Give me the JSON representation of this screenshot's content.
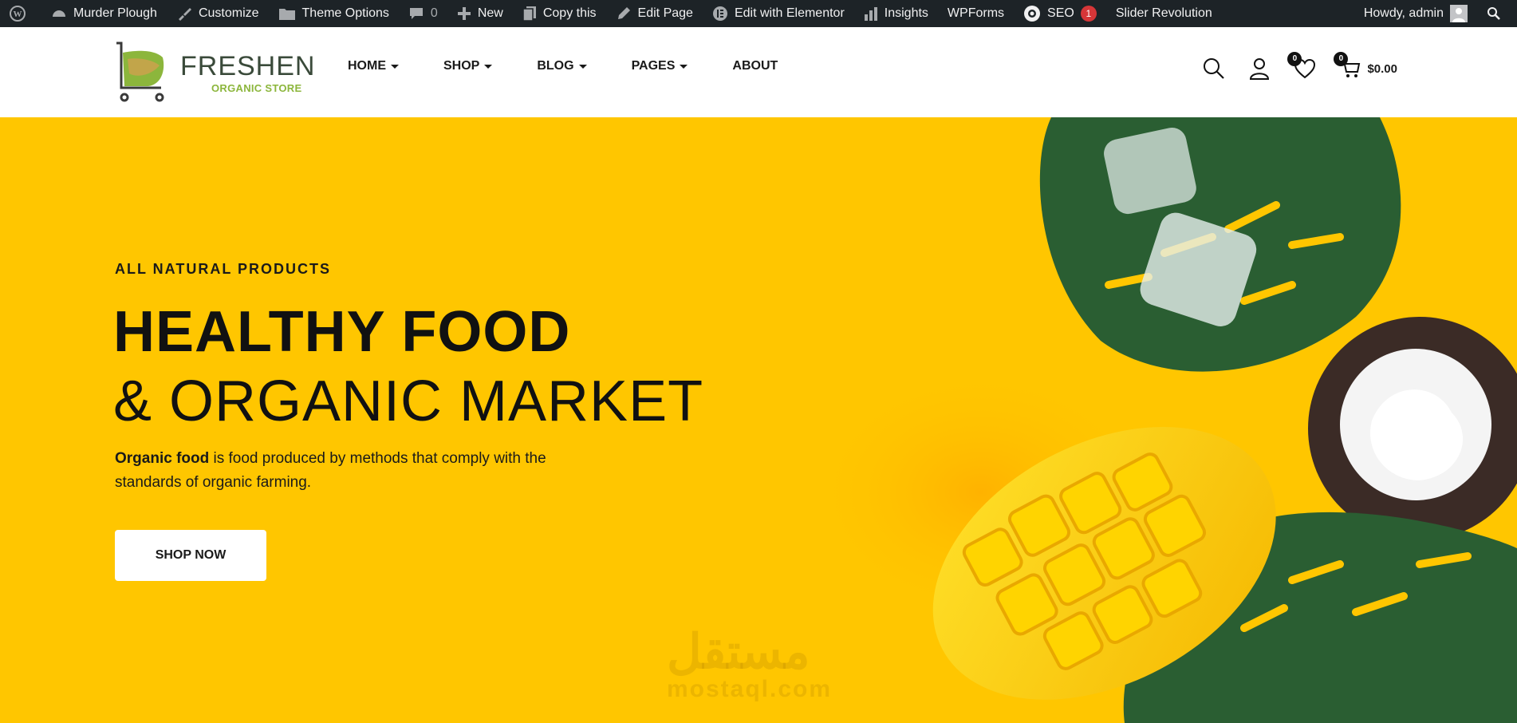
{
  "admin_bar": {
    "site_name": "Murder Plough",
    "customize": "Customize",
    "theme_options": "Theme Options",
    "comments_count": "0",
    "new": "New",
    "copy_this": "Copy this",
    "edit_page": "Edit Page",
    "edit_with_elementor": "Edit with Elementor",
    "insights": "Insights",
    "wpforms": "WPForms",
    "seo": "SEO",
    "seo_badge": "1",
    "slider_revolution": "Slider Revolution",
    "greeting": "Howdy, admin"
  },
  "header": {
    "brand": "FRESHEN",
    "brand_sub": "ORGANIC STORE",
    "nav": [
      {
        "label": "HOME"
      },
      {
        "label": "SHOP"
      },
      {
        "label": "BLOG"
      },
      {
        "label": "PAGES"
      },
      {
        "label": "ABOUT"
      }
    ],
    "wishlist_count": "0",
    "cart_count": "0",
    "cart_total": "$0.00"
  },
  "hero": {
    "eyebrow": "ALL NATURAL PRODUCTS",
    "title_line1": "HEALTHY FOOD",
    "title_line2": "& ORGANIC MARKET",
    "desc_bold": "Organic food",
    "desc_rest": " is food produced by methods that comply with the standards of organic farming.",
    "cta": "SHOP NOW"
  },
  "watermark": {
    "arabic": "مستقل",
    "latin": "mostaql.com"
  },
  "colors": {
    "hero_bg": "#ffc600",
    "admin_bar": "#1d2327",
    "brand_green": "#8cb63c",
    "leaf_green": "#2a5e32"
  }
}
